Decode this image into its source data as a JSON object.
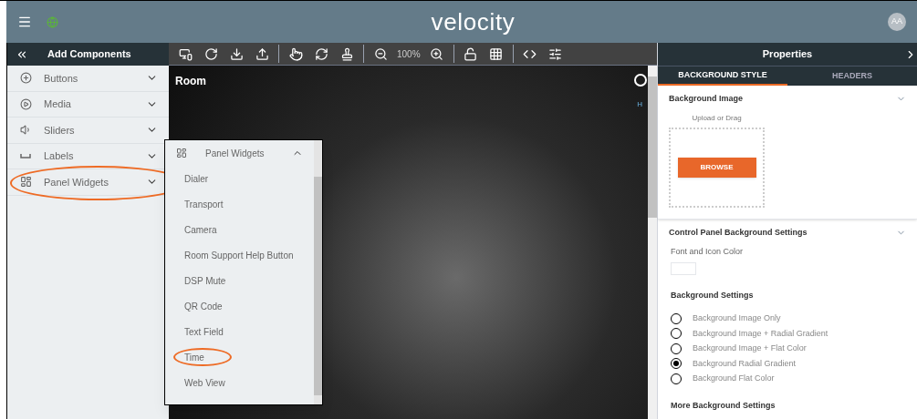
{
  "header": {
    "logo": "velocity",
    "avatar": "AA"
  },
  "components_panel": {
    "title": "Add Components",
    "items": [
      {
        "label": "Buttons",
        "kind": "plus",
        "highlighted": false
      },
      {
        "label": "Media",
        "kind": "play",
        "highlighted": false
      },
      {
        "label": "Sliders",
        "kind": "volume",
        "highlighted": false
      },
      {
        "label": "Labels",
        "kind": "space",
        "highlighted": false
      },
      {
        "label": "Panel Widgets",
        "kind": "widgets",
        "highlighted": true
      }
    ]
  },
  "widgets_popup": {
    "title": "Panel Widgets",
    "expanded": true,
    "items": [
      {
        "label": "Dialer",
        "highlighted": false
      },
      {
        "label": "Transport",
        "highlighted": false
      },
      {
        "label": "Camera",
        "highlighted": false
      },
      {
        "label": "Room Support Help Button",
        "highlighted": false
      },
      {
        "label": "DSP Mute",
        "highlighted": false
      },
      {
        "label": "QR Code",
        "highlighted": false
      },
      {
        "label": "Text Field",
        "highlighted": false
      },
      {
        "label": "Time",
        "highlighted": true
      },
      {
        "label": "Web View",
        "highlighted": false
      }
    ]
  },
  "toolbar": {
    "zoom": "100%"
  },
  "canvas": {
    "title": "Room",
    "partial_label": "H"
  },
  "properties": {
    "title": "Properties",
    "tabs": [
      {
        "label": "BACKGROUND STYLE",
        "selected": true
      },
      {
        "label": "HEADERS",
        "selected": false
      }
    ],
    "background_image": {
      "title": "Background Image",
      "hint": "Upload or Drag",
      "button": "BROWSE"
    },
    "panel_settings": {
      "title": "Control Panel Background Settings",
      "font_color_label": "Font and Icon Color",
      "background_settings_title": "Background Settings",
      "options": [
        {
          "label": "Background Image Only",
          "selected": false
        },
        {
          "label": "Background Image + Radial Gradient",
          "selected": false
        },
        {
          "label": "Background Image + Flat Color",
          "selected": false
        },
        {
          "label": "Background Radial Gradient",
          "selected": true
        },
        {
          "label": "Background Flat Color",
          "selected": false
        }
      ],
      "more_title": "More Background Settings"
    }
  }
}
